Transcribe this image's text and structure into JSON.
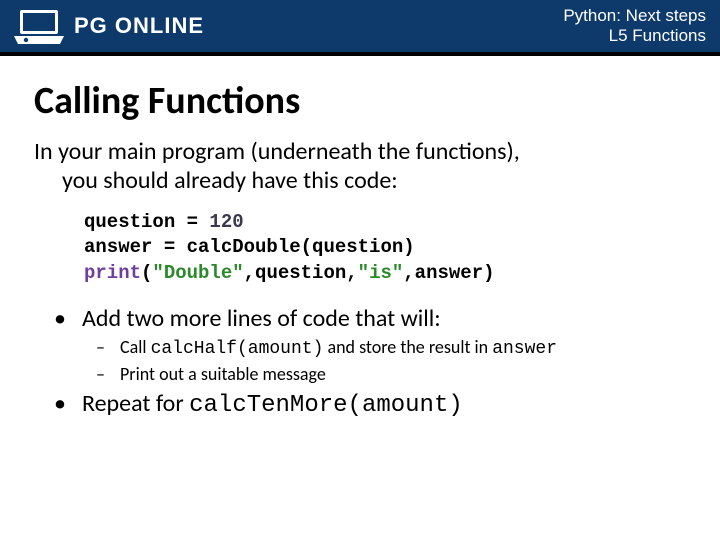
{
  "header": {
    "brand_pg": "PG",
    "brand_online": " ONLINE",
    "course": "Python: Next steps",
    "lesson": "L5 Functions"
  },
  "slide": {
    "title": "Calling Functions",
    "intro_line1": "In your main program (underneath the functions),",
    "intro_line2": "you should already have this code:",
    "code": {
      "l1_a": "question = ",
      "l1_num": "120",
      "l2": "answer = calcDouble(question)",
      "l3_print": "print",
      "l3_a": "(",
      "l3_s1": "\"Double\"",
      "l3_b": ",question,",
      "l3_s2": "\"is\"",
      "l3_c": ",answer)"
    },
    "bullet1": "Add two more lines of code that will:",
    "sub1_a": "Call ",
    "sub1_code1": "calcHalf(amount)",
    "sub1_b": " and store the result in ",
    "sub1_code2": "answer",
    "sub2": "Print out a suitable message",
    "bullet2_a": "Repeat for ",
    "bullet2_code": "calcTenMore(amount)"
  }
}
